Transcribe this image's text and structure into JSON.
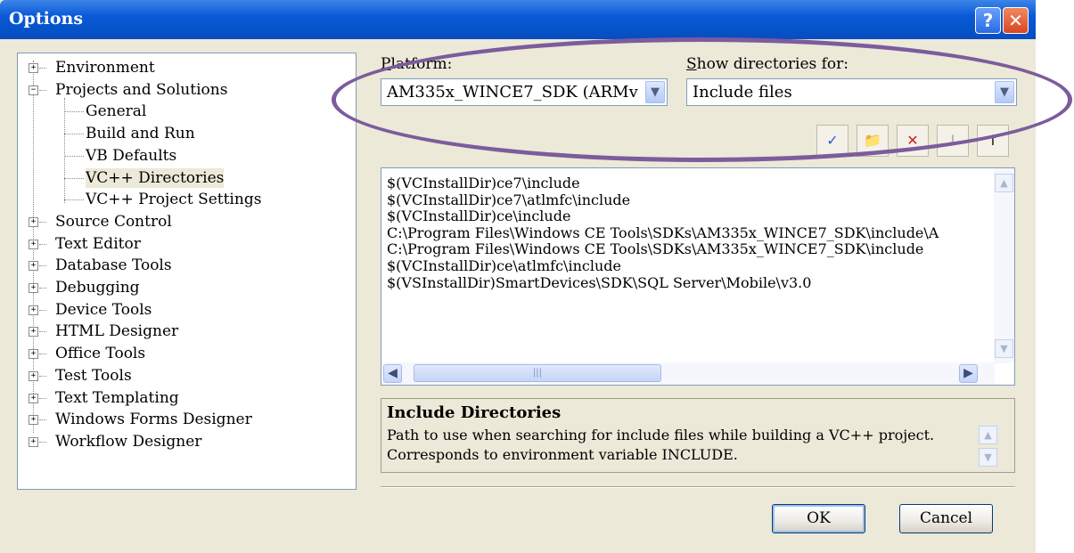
{
  "window": {
    "title": "Options"
  },
  "title_buttons": {
    "help": "?",
    "close": "✕"
  },
  "tree": {
    "items": [
      {
        "label": "Environment",
        "expander": "+"
      },
      {
        "label": "Projects and Solutions",
        "expander": "−"
      },
      {
        "label": "General",
        "child": true
      },
      {
        "label": "Build and Run",
        "child": true
      },
      {
        "label": "VB Defaults",
        "child": true
      },
      {
        "label": "VC++ Directories",
        "child": true,
        "selected": true
      },
      {
        "label": "VC++ Project Settings",
        "child": true
      },
      {
        "label": "Source Control",
        "expander": "+"
      },
      {
        "label": "Text Editor",
        "expander": "+"
      },
      {
        "label": "Database Tools",
        "expander": "+"
      },
      {
        "label": "Debugging",
        "expander": "+"
      },
      {
        "label": "Device Tools",
        "expander": "+"
      },
      {
        "label": "HTML Designer",
        "expander": "+"
      },
      {
        "label": "Office Tools",
        "expander": "+"
      },
      {
        "label": "Test Tools",
        "expander": "+"
      },
      {
        "label": "Text Templating",
        "expander": "+"
      },
      {
        "label": "Windows Forms Designer",
        "expander": "+"
      },
      {
        "label": "Workflow Designer",
        "expander": "+"
      }
    ]
  },
  "platform": {
    "label_first": "P",
    "label_rest": "latform:",
    "value": "AM335x_WINCE7_SDK (ARMv"
  },
  "show_dirs": {
    "label_first": "S",
    "label_rest": "how directories for:",
    "value": "Include files"
  },
  "toolbar": {
    "buttons": [
      {
        "icon": "checkmark-icon",
        "glyph": "✓"
      },
      {
        "icon": "new-folder-icon",
        "glyph": "📁"
      },
      {
        "icon": "delete-icon",
        "glyph": "✕"
      },
      {
        "icon": "move-down-icon",
        "glyph": "↓"
      },
      {
        "icon": "move-up-icon",
        "glyph": "↑"
      }
    ]
  },
  "directories": [
    "$(VCInstallDir)ce7\\include",
    "$(VCInstallDir)ce7\\atlmfc\\include",
    "$(VCInstallDir)ce\\include",
    "C:\\Program Files\\Windows CE Tools\\SDKs\\AM335x_WINCE7_SDK\\include\\A",
    "C:\\Program Files\\Windows CE Tools\\SDKs\\AM335x_WINCE7_SDK\\include",
    "$(VCInstallDir)ce\\atlmfc\\include",
    "$(VSInstallDir)SmartDevices\\SDK\\SQL Server\\Mobile\\v3.0"
  ],
  "description": {
    "title": "Include Directories",
    "line1": "Path to use when searching for include files while building a VC++ project.",
    "line2": "Corresponds to environment variable INCLUDE."
  },
  "buttons": {
    "ok": "OK",
    "cancel": "Cancel"
  },
  "colors": {
    "title_bar": "#0553c8",
    "highlight_ellipse": "#7c5c9c",
    "dialog_bg": "#ece9d8"
  }
}
